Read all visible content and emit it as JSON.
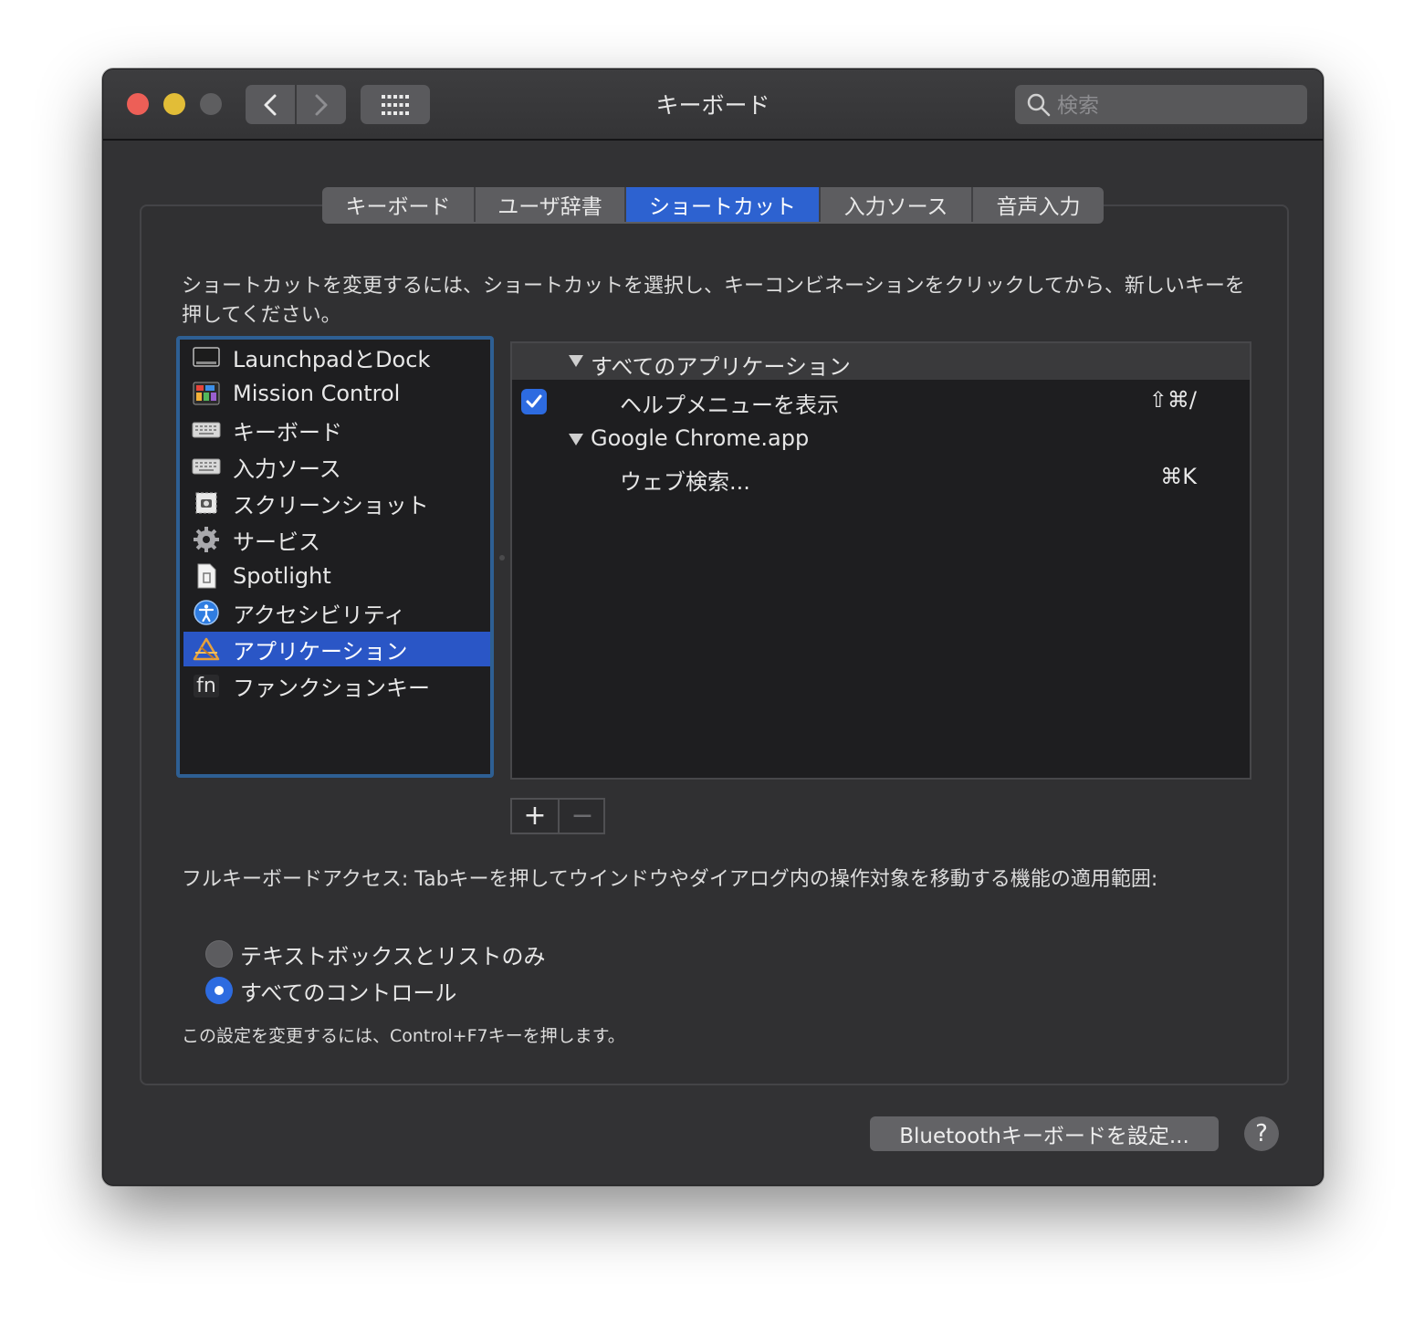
{
  "window": {
    "title": "キーボード",
    "search_placeholder": "検索"
  },
  "tabs": [
    {
      "label": "キーボード",
      "active": false
    },
    {
      "label": "ユーザ辞書",
      "active": false
    },
    {
      "label": "ショートカット",
      "active": true
    },
    {
      "label": "入力ソース",
      "active": false
    },
    {
      "label": "音声入力",
      "active": false
    }
  ],
  "instructions": "ショートカットを変更するには、ショートカットを選択し、キーコンビネーションをクリックしてから、新しいキーを押してください。",
  "categories": [
    {
      "label": "LaunchpadとDock",
      "icon": "launchpad-icon"
    },
    {
      "label": "Mission Control",
      "icon": "mission-control-icon"
    },
    {
      "label": "キーボード",
      "icon": "keyboard-icon"
    },
    {
      "label": "入力ソース",
      "icon": "keyboard-icon"
    },
    {
      "label": "スクリーンショット",
      "icon": "screenshot-icon"
    },
    {
      "label": "サービス",
      "icon": "gear-icon"
    },
    {
      "label": "Spotlight",
      "icon": "document-icon"
    },
    {
      "label": "アクセシビリティ",
      "icon": "accessibility-icon"
    },
    {
      "label": "アプリケーション",
      "icon": "app-store-icon",
      "selected": true
    },
    {
      "label": "ファンクションキー",
      "icon": "fn-icon",
      "text": "fn"
    }
  ],
  "shortcuts": {
    "group1": {
      "label": "すべてのアプリケーション"
    },
    "item1": {
      "label": "ヘルプメニューを表示",
      "keys": "⇧⌘/",
      "checked": true
    },
    "group2": {
      "label": "Google Chrome.app"
    },
    "item2": {
      "label": "ウェブ検索...",
      "keys": "⌘K"
    }
  },
  "buttons": {
    "add": "+",
    "remove": "−",
    "bluetooth": "Bluetoothキーボードを設定...",
    "help": "?"
  },
  "full_keyboard_access": {
    "label": "フルキーボードアクセス: Tabキーを押してウインドウやダイアログ内の操作対象を移動する機能の適用範囲:",
    "options": [
      {
        "label": "テキストボックスとリストのみ",
        "selected": false
      },
      {
        "label": "すべてのコントロール",
        "selected": true
      }
    ],
    "note": "この設定を変更するには、Control+F7キーを押します。"
  },
  "colors": {
    "accent": "#2d62d0",
    "selection": "#2a56c6",
    "close": "#ed5f57",
    "minimize": "#e2bd37"
  }
}
